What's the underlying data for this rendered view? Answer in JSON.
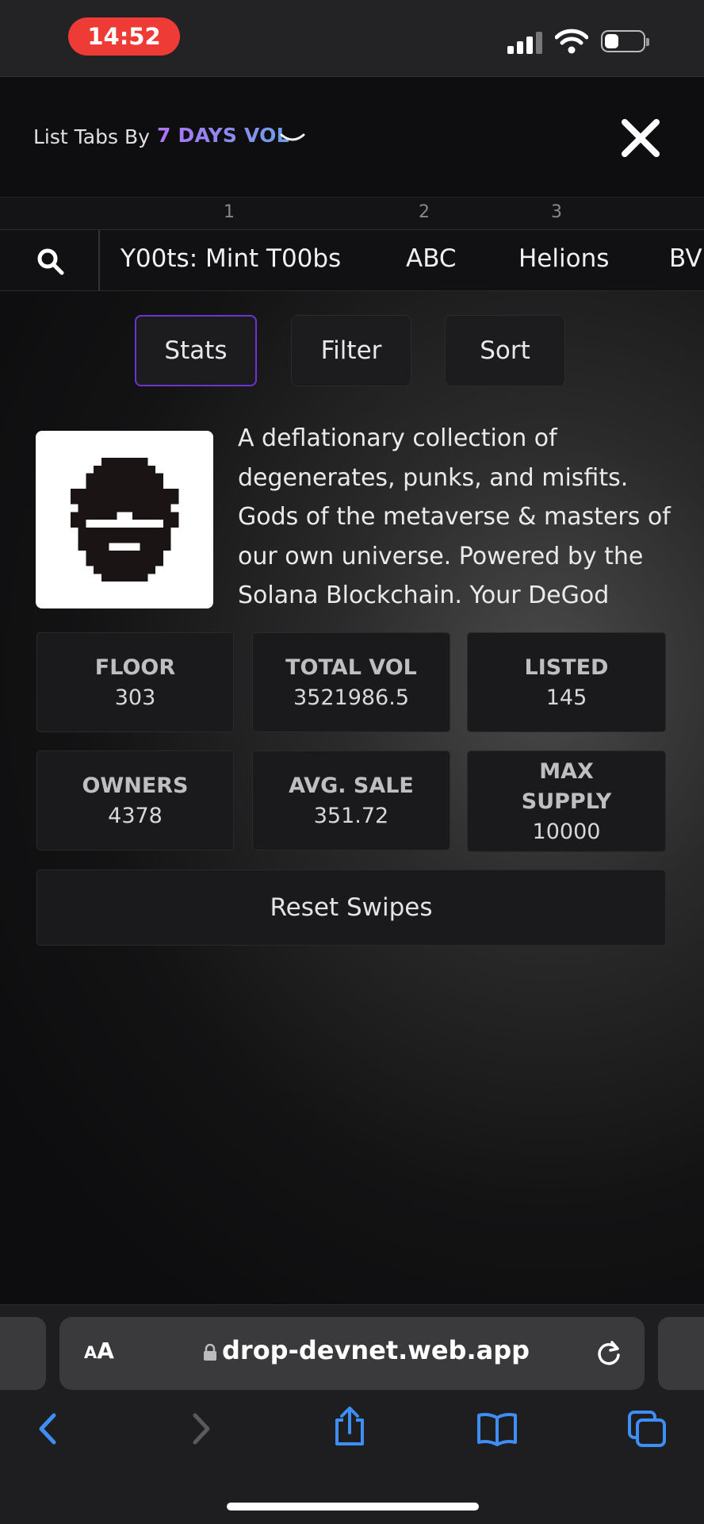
{
  "status_bar": {
    "time": "14:52"
  },
  "header": {
    "list_label": "List Tabs By",
    "sort_value": "7 DAYS VOL"
  },
  "ranks": [
    "1",
    "2",
    "3"
  ],
  "collection_tabs": [
    "Y00ts: Mint T00bs",
    "ABC",
    "Helions",
    "BV"
  ],
  "segments": {
    "stats": "Stats",
    "filter": "Filter",
    "sort": "Sort"
  },
  "collection": {
    "description": "A deflationary collection of degenerates, punks, and misfits. Gods of the metaverse & masters of our own universe. Powered by the Solana Blockchain. Your DeGod"
  },
  "stats": [
    {
      "label": "FLOOR",
      "value": "303"
    },
    {
      "label": "TOTAL VOL",
      "value": "3521986.5"
    },
    {
      "label": "LISTED",
      "value": "145"
    },
    {
      "label": "OWNERS",
      "value": "4378"
    },
    {
      "label": "AVG. SALE",
      "value": "351.72"
    },
    {
      "label": "MAX SUPPLY",
      "value": "10000"
    }
  ],
  "reset_button": "Reset Swipes",
  "browser": {
    "aa_big": "A",
    "aa_small": "A",
    "url": "drop-devnet.web.app"
  },
  "colors": {
    "accent": "#6b35d6",
    "sort_gradient_start": "#b173f6",
    "sort_gradient_end": "#6c9ee8",
    "status_pill": "#ef3b36",
    "ios_blue": "#3e8ef7"
  },
  "icons": [
    "search-icon",
    "close-icon",
    "chevron-down-icon",
    "lock-icon",
    "reload-icon",
    "back-icon",
    "forward-icon",
    "share-icon",
    "bookmarks-icon",
    "tabs-icon"
  ]
}
